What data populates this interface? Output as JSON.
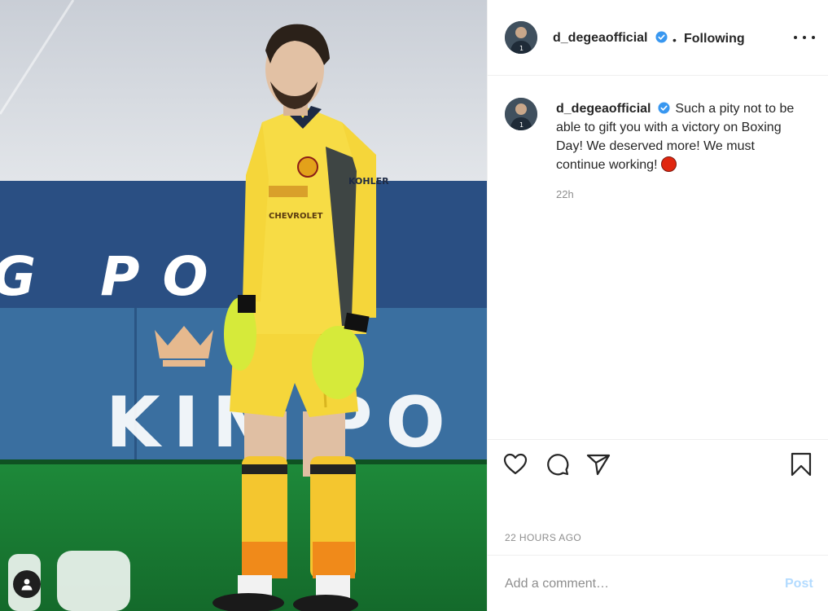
{
  "post": {
    "username": "d_degeaofficial",
    "verified": true,
    "follow_separator": "•",
    "follow_status": "Following",
    "more_icon": "more-horizontal-icon"
  },
  "photo": {
    "board_text_top": "G PO  N",
    "board_text_bottom": "KIN  PO",
    "shirt_sponsor": "CHEVROLET",
    "sleeve_sponsor": "KOHLER",
    "tag_icon": "user-tag-icon"
  },
  "caption": {
    "username": "d_degeaofficial",
    "text": "Such a pity not to be able to gift you with a victory on Boxing Day! We deserved more! We must continue working!",
    "emoji": "red-circle-emoji",
    "time": "22h"
  },
  "actions": {
    "like_icon": "heart-icon",
    "comment_icon": "comment-icon",
    "share_icon": "send-icon",
    "save_icon": "bookmark-icon"
  },
  "timestamp": "22 HOURS AGO",
  "comment_box": {
    "placeholder": "Add a comment…",
    "post_label": "Post"
  },
  "colors": {
    "verified_blue": "#3897f0",
    "post_disabled": "#b3dbff",
    "meta_gray": "#8e8e8e",
    "jersey_yellow": "#f5d63a"
  }
}
